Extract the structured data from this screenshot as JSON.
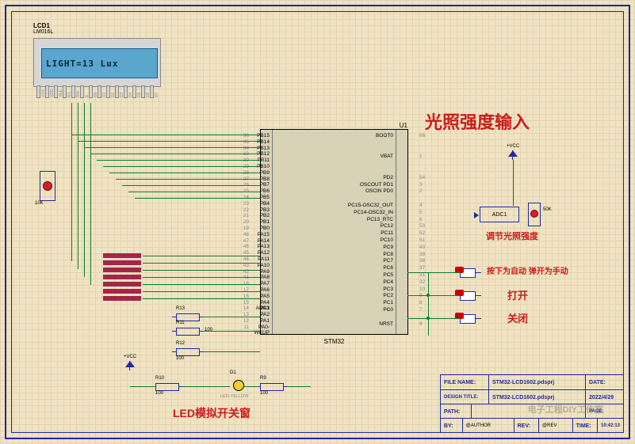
{
  "lcd": {
    "ref": "LCD1",
    "model": "LM016L",
    "display_text": "LIGHT=13 Lux",
    "pins": [
      "VSS",
      "VDD",
      "VEE",
      "RS",
      "RW",
      "E",
      "D0",
      "D1",
      "D2",
      "D3",
      "D4",
      "D5",
      "D6",
      "D7"
    ]
  },
  "mcu": {
    "ref": "U1",
    "name": "STM32",
    "left_pins": [
      {
        "n": "36",
        "l": "PB15"
      },
      {
        "n": "35",
        "l": "PB14"
      },
      {
        "n": "34",
        "l": "PB13"
      },
      {
        "n": "33",
        "l": "PB12"
      },
      {
        "n": "30",
        "l": "PB11"
      },
      {
        "n": "29",
        "l": "PB10"
      },
      {
        "n": "28",
        "l": "PB9"
      },
      {
        "n": "27",
        "l": "PB8"
      },
      {
        "n": "26",
        "l": "PB7"
      },
      {
        "n": "25",
        "l": "PB6"
      },
      {
        "n": "24",
        "l": "PB5"
      },
      {
        "n": "23",
        "l": "PB4"
      },
      {
        "n": "22",
        "l": "PB3"
      },
      {
        "n": "21",
        "l": "PB2"
      },
      {
        "n": "20",
        "l": "PB1"
      },
      {
        "n": "19",
        "l": "PB0"
      },
      {
        "n": "48",
        "l": "PA15"
      },
      {
        "n": "47",
        "l": "PA14"
      },
      {
        "n": "46",
        "l": "PA13"
      },
      {
        "n": "45",
        "l": "PA12"
      },
      {
        "n": "44",
        "l": "PA11"
      },
      {
        "n": "43",
        "l": "PA10"
      },
      {
        "n": "42",
        "l": "PA9"
      },
      {
        "n": "41",
        "l": "PA8"
      },
      {
        "n": "18",
        "l": "PA7"
      },
      {
        "n": "17",
        "l": "PA6"
      },
      {
        "n": "16",
        "l": "PA5"
      },
      {
        "n": "15",
        "l": "PA4 ADC1"
      },
      {
        "n": "14",
        "l": "PA3"
      },
      {
        "n": "13",
        "l": "PA2"
      },
      {
        "n": "12",
        "l": "PA1"
      },
      {
        "n": "11",
        "l": "PA0-WKUP"
      }
    ],
    "right_pins": [
      {
        "n": "66",
        "l": "BOOT0"
      },
      {
        "n": "",
        "l": ""
      },
      {
        "n": "",
        "l": ""
      },
      {
        "n": "1",
        "l": "VBAT"
      },
      {
        "n": "",
        "l": ""
      },
      {
        "n": "",
        "l": ""
      },
      {
        "n": "54",
        "l": "PD2"
      },
      {
        "n": "3",
        "l": "OSCOUT PD1"
      },
      {
        "n": "2",
        "l": "OSCIN PD0"
      },
      {
        "n": "",
        "l": ""
      },
      {
        "n": "4",
        "l": "PC15-OSC32_OUT"
      },
      {
        "n": "5",
        "l": "PC14-OSC32_IN"
      },
      {
        "n": "6",
        "l": "PC13_RTC"
      },
      {
        "n": "53",
        "l": "PC12"
      },
      {
        "n": "52",
        "l": "PC11"
      },
      {
        "n": "51",
        "l": "PC10"
      },
      {
        "n": "40",
        "l": "PC9"
      },
      {
        "n": "39",
        "l": "PC8"
      },
      {
        "n": "38",
        "l": "PC7"
      },
      {
        "n": "37",
        "l": "PC6"
      },
      {
        "n": "31",
        "l": "PC5"
      },
      {
        "n": "32",
        "l": "PC4"
      },
      {
        "n": "10",
        "l": "PC3"
      },
      {
        "n": "9",
        "l": "PC2"
      },
      {
        "n": "8",
        "l": "PC1"
      },
      {
        "n": "7",
        "l": "PC0"
      },
      {
        "n": "",
        "l": ""
      },
      {
        "n": "9",
        "l": "NRST"
      }
    ]
  },
  "annotations": {
    "light_input_title": "光照强度输入",
    "adjust_light": "调节光照强度",
    "auto_manual": "按下为自动 弹开为手动",
    "open": "打开",
    "close": "关闭",
    "led_sim": "LED模拟开关窗",
    "vcc": "+VCC",
    "adc_label": "ADC1"
  },
  "components": {
    "R9": {
      "ref": "R9",
      "val": "100"
    },
    "R10": {
      "ref": "R10",
      "val": "100"
    },
    "R11": {
      "ref": "R11",
      "val": "100"
    },
    "R12": {
      "ref": "R12",
      "val": "100"
    },
    "R13": {
      "ref": "R13",
      "val": "100"
    },
    "D1": {
      "ref": "D1",
      "val": "LED-YELLOW"
    },
    "pot1": {
      "val": "10K"
    },
    "pot2": {
      "val": "50K"
    }
  },
  "title_block": {
    "file_name_lbl": "FILE NAME:",
    "file_name": "STM32-LCD1602.pdsprj",
    "design_title_lbl": "DESIGN TITLE:",
    "design_title": "STM32-LCD1602.pdsprj",
    "path_lbl": "PATH:",
    "path": "",
    "by_lbl": "BY:",
    "by": "@AUTHOR",
    "date_lbl": "DATE:",
    "date": "2022/4/29",
    "rev_lbl": "REV:",
    "rev": "@REV",
    "time_lbl": "TIME:",
    "time": "10:42:13",
    "page_lbl": "PAGE:",
    "page": ""
  },
  "watermark": "电子工程DIY工作室"
}
